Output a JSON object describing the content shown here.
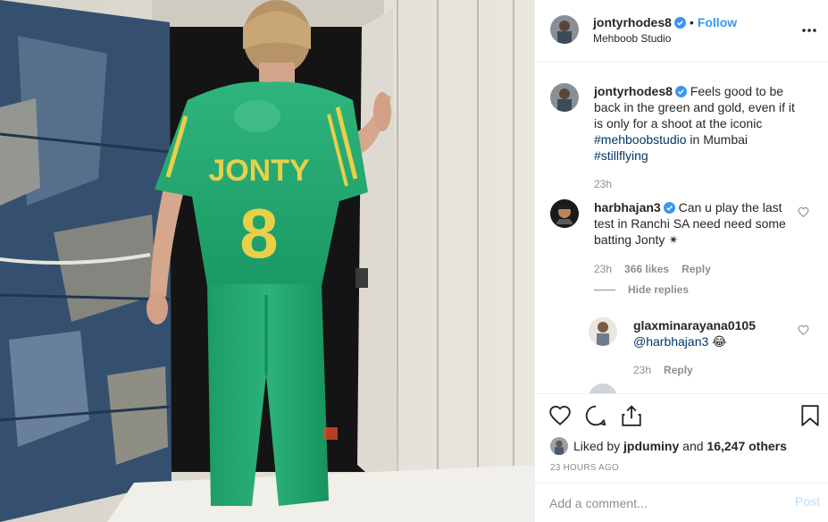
{
  "post": {
    "author": "jontyrhodes8",
    "follow_label": "Follow",
    "separator": "•",
    "location": "Mehboob Studio",
    "image_alt": "Man in green and gold cricket shirt with JONTY 8 on the back, walking into a doorway",
    "jersey_name": "JONTY",
    "jersey_number": "8"
  },
  "caption": {
    "user": "jontyrhodes8",
    "text_before": "Feels good to be back in the green and gold, even if it is only for a shoot at the iconic ",
    "hashtag1": "#mehboobstudio",
    "text_mid": " in Mumbai ",
    "hashtag2": "#stillflying",
    "time": "23h"
  },
  "comment1": {
    "user": "harbhajan3",
    "text": "Can u play the last test in Ranchi SA need need some batting Jonty ✴",
    "time": "23h",
    "likes": "366 likes",
    "reply_label": "Reply",
    "hide_replies": "Hide replies"
  },
  "reply1": {
    "user": "glaxminarayana0105",
    "mention": "@harbhajan3",
    "emoji": "😂",
    "time": "23h",
    "reply_label": "Reply"
  },
  "likes": {
    "prefix": "Liked by",
    "user": "jpduminy",
    "joiner": "and",
    "count": "16,247 others"
  },
  "posted_ago": "23 HOURS AGO",
  "add_comment": {
    "placeholder": "Add a comment...",
    "post_label": "Post"
  },
  "colors": {
    "link_blue": "#3897f0",
    "hashtag": "#003569",
    "muted": "#8e8e8e",
    "jersey_green": "#1fae72",
    "jersey_gold": "#e8d04a"
  }
}
